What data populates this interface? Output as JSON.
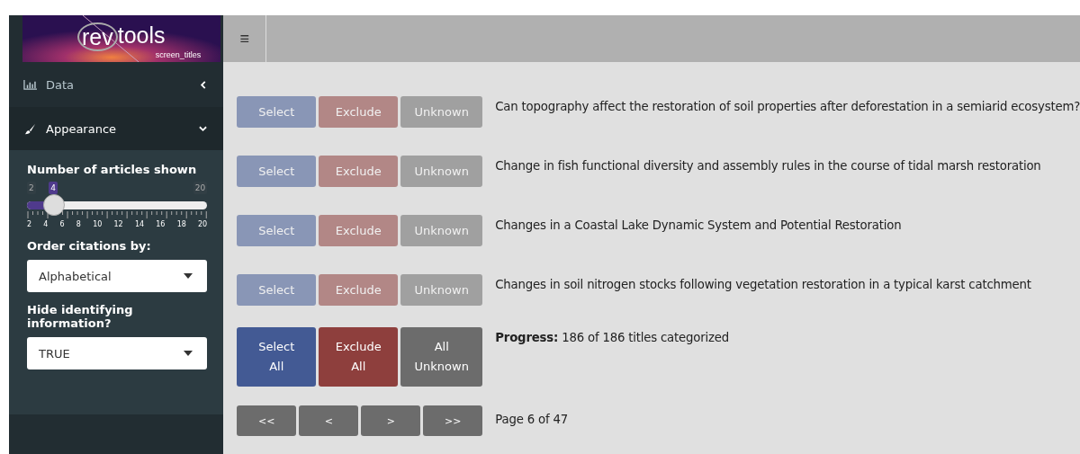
{
  "logo": {
    "word_1": "rev",
    "word_2": "tools",
    "subtitle": "screen_titles"
  },
  "sidebar": {
    "items": [
      {
        "label": "Data",
        "expanded": false
      },
      {
        "label": "Appearance",
        "expanded": true
      }
    ],
    "slider": {
      "label": "Number of articles shown",
      "min_label": "2",
      "value_label": "4",
      "max_label": "20",
      "level": 0.111,
      "ticks": [
        "2",
        "4",
        "6",
        "8",
        "10",
        "12",
        "14",
        "16",
        "18",
        "20"
      ]
    },
    "selects": [
      {
        "label": "Order citations by:",
        "value": "Alphabetical"
      },
      {
        "label": "Hide identifying information?",
        "value": "TRUE"
      }
    ]
  },
  "header": {
    "menu_icon": "≡"
  },
  "articles": [
    {
      "buttons": [
        "Select",
        "Exclude",
        "Unknown"
      ],
      "title": "Can topography affect the restoration of soil properties after deforestation in a semiarid ecosystem?"
    },
    {
      "buttons": [
        "Select",
        "Exclude",
        "Unknown"
      ],
      "title": "Change in fish functional diversity and assembly rules in the course of tidal marsh restoration"
    },
    {
      "buttons": [
        "Select",
        "Exclude",
        "Unknown"
      ],
      "title": "Changes in a Coastal Lake Dynamic System and Potential Restoration"
    },
    {
      "buttons": [
        "Select",
        "Exclude",
        "Unknown"
      ],
      "title": "Changes in soil nitrogen stocks following vegetation restoration in a typical karst catchment"
    }
  ],
  "bulk_buttons": [
    [
      "Select",
      "All"
    ],
    [
      "Exclude",
      "All"
    ],
    [
      "All",
      "Unknown"
    ]
  ],
  "progress": {
    "label": "Progress:",
    "text": "186 of 186 titles categorized"
  },
  "pager": {
    "buttons": [
      "<<",
      "<",
      ">",
      ">>"
    ],
    "text": "Page 6 of 47"
  }
}
